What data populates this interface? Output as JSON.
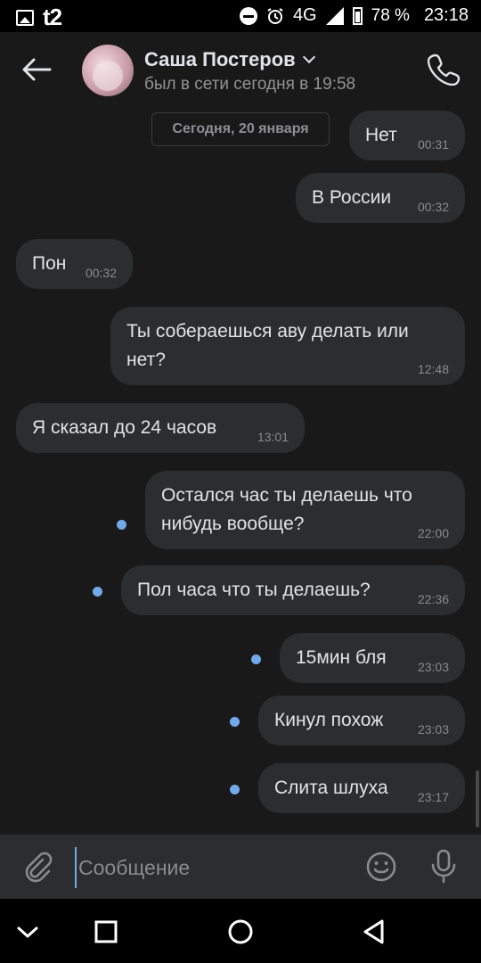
{
  "status_bar": {
    "carrier": "t2",
    "network": "4G",
    "battery": "78 %",
    "time": "23:18"
  },
  "header": {
    "contact_name": "Саша Постеров",
    "status": "был в сети сегодня в 19:58"
  },
  "date_chip": "Сегодня, 20 января",
  "messages": [
    {
      "text": "Нет",
      "time": "00:31",
      "out": true
    },
    {
      "text": "В России",
      "time": "00:32",
      "out": true
    },
    {
      "text": "Пон",
      "time": "00:32",
      "out": false
    },
    {
      "text": "Ты собераешься аву делать или нет?",
      "line1": "Ты собераешься аву делать или",
      "line2": "нет?",
      "time": "12:48",
      "out": true
    },
    {
      "text": "Я сказал до 24 часов",
      "time": "13:01",
      "out": false
    },
    {
      "text": "Остался час ты делаешь что нибудь вообще?",
      "line1": "Остался час ты делаешь что",
      "line2": "нибудь вообще?",
      "time": "22:00",
      "out": true,
      "unread": true
    },
    {
      "text": "Пол часа что ты делаешь?",
      "time": "22:36",
      "out": true,
      "unread": true
    },
    {
      "text": "15мин бля",
      "time": "23:03",
      "out": true,
      "unread": true
    },
    {
      "text": "Кинул похож",
      "time": "23:03",
      "out": true,
      "unread": true
    },
    {
      "text": "Слита шлуха",
      "time": "23:17",
      "out": true,
      "unread": true
    }
  ],
  "composer": {
    "placeholder": "Сообщение"
  },
  "icons": {
    "back": "arrow-left-icon",
    "call": "phone-icon",
    "attach": "paperclip-icon",
    "emoji": "smile-icon",
    "mic": "microphone-icon",
    "nav": [
      "chevron-down-icon",
      "square-icon",
      "circle-icon",
      "triangle-back-icon"
    ]
  },
  "colors": {
    "background": "#191919",
    "bubble": "#2c2d2e",
    "unread_dot": "#71aaeb",
    "text_secondary": "#939393"
  }
}
